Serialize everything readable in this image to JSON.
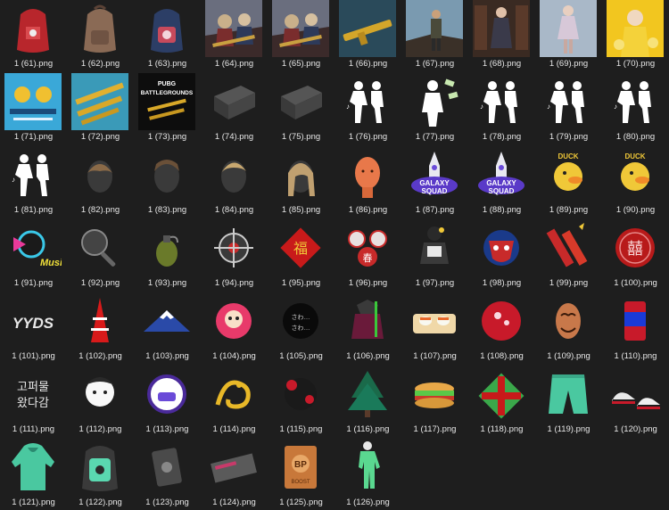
{
  "view": "large-icons",
  "files": [
    {
      "name": "1 (61).png",
      "icon": "red-backpack"
    },
    {
      "name": "1 (62).png",
      "icon": "brown-backpack"
    },
    {
      "name": "1 (63).png",
      "icon": "navy-backpack"
    },
    {
      "name": "1 (64).png",
      "icon": "battle-poster"
    },
    {
      "name": "1 (65).png",
      "icon": "battle-poster"
    },
    {
      "name": "1 (66).png",
      "icon": "golden-rifle"
    },
    {
      "name": "1 (67).png",
      "icon": "soldier-scene"
    },
    {
      "name": "1 (68).png",
      "icon": "woman-library"
    },
    {
      "name": "1 (69).png",
      "icon": "woman-street"
    },
    {
      "name": "1 (70).png",
      "icon": "yellow-poster"
    },
    {
      "name": "1 (71).png",
      "icon": "blue-event-banner"
    },
    {
      "name": "1 (72).png",
      "icon": "golden-weapons-banner"
    },
    {
      "name": "1 (73).png",
      "icon": "battlegrounds-poster"
    },
    {
      "name": "1 (74).png",
      "icon": "grey-crate"
    },
    {
      "name": "1 (75).png",
      "icon": "grey-crate"
    },
    {
      "name": "1 (76).png",
      "icon": "dance-emote"
    },
    {
      "name": "1 (77).png",
      "icon": "money-emote"
    },
    {
      "name": "1 (78).png",
      "icon": "dance-emote"
    },
    {
      "name": "1 (79).png",
      "icon": "dance-emote"
    },
    {
      "name": "1 (80).png",
      "icon": "dance-emote"
    },
    {
      "name": "1 (81).png",
      "icon": "dance-emote"
    },
    {
      "name": "1 (82).png",
      "icon": "hair-bowl"
    },
    {
      "name": "1 (83).png",
      "icon": "hair-short"
    },
    {
      "name": "1 (84).png",
      "icon": "hair-blond"
    },
    {
      "name": "1 (85).png",
      "icon": "hair-long"
    },
    {
      "name": "1 (86).png",
      "icon": "orange-head"
    },
    {
      "name": "1 (87).png",
      "icon": "galaxy-squad-logo"
    },
    {
      "name": "1 (88).png",
      "icon": "galaxy-squad-logo"
    },
    {
      "name": "1 (89).png",
      "icon": "duck-logo"
    },
    {
      "name": "1 (90).png",
      "icon": "duck-logo"
    },
    {
      "name": "1 (91).png",
      "icon": "music-spray"
    },
    {
      "name": "1 (92).png",
      "icon": "pan-icon"
    },
    {
      "name": "1 (93).png",
      "icon": "grenade-icon"
    },
    {
      "name": "1 (94).png",
      "icon": "crosshair-icon"
    },
    {
      "name": "1 (95).png",
      "icon": "red-diamond-charm"
    },
    {
      "name": "1 (96).png",
      "icon": "lanterns-spray"
    },
    {
      "name": "1 (97).png",
      "icon": "soldier-figure"
    },
    {
      "name": "1 (98).png",
      "icon": "mask-emblem"
    },
    {
      "name": "1 (99).png",
      "icon": "firecracker-icon"
    },
    {
      "name": "1 (100).png",
      "icon": "red-seal"
    },
    {
      "name": "1 (101).png",
      "icon": "yyds-text"
    },
    {
      "name": "1 (102).png",
      "icon": "tower-icon"
    },
    {
      "name": "1 (103).png",
      "icon": "mountain-icon"
    },
    {
      "name": "1 (104).png",
      "icon": "daruma-icon"
    },
    {
      "name": "1 (105).png",
      "icon": "black-ink-spray"
    },
    {
      "name": "1 (106).png",
      "icon": "samurai-figure"
    },
    {
      "name": "1 (107).png",
      "icon": "sushi-icon"
    },
    {
      "name": "1 (108).png",
      "icon": "red-circle-icon"
    },
    {
      "name": "1 (109).png",
      "icon": "mask-icon"
    },
    {
      "name": "1 (110).png",
      "icon": "can-icon"
    },
    {
      "name": "1 (111).png",
      "icon": "korean-text"
    },
    {
      "name": "1 (112).png",
      "icon": "cartoon-face"
    },
    {
      "name": "1 (113).png",
      "icon": "purple-badge"
    },
    {
      "name": "1 (114).png",
      "icon": "dragon-icon"
    },
    {
      "name": "1 (115).png",
      "icon": "ink-splat-icon"
    },
    {
      "name": "1 (116).png",
      "icon": "tree-icon"
    },
    {
      "name": "1 (117).png",
      "icon": "sandwich-icon"
    },
    {
      "name": "1 (118).png",
      "icon": "gift-box-icon"
    },
    {
      "name": "1 (119).png",
      "icon": "shorts-icon"
    },
    {
      "name": "1 (120).png",
      "icon": "sneakers-icon"
    },
    {
      "name": "1 (121).png",
      "icon": "hoodie-icon"
    },
    {
      "name": "1 (122).png",
      "icon": "teal-backpack"
    },
    {
      "name": "1 (123).png",
      "icon": "metal-plate-icon"
    },
    {
      "name": "1 (124).png",
      "icon": "ticket-icon"
    },
    {
      "name": "1 (125).png",
      "icon": "bp-card-icon"
    },
    {
      "name": "1 (126).png",
      "icon": "suit-icon"
    }
  ],
  "text": {
    "korean": "고퍼물 왔다감",
    "yyds": "YYDS",
    "galaxy": "GALAXY",
    "squad": "SQUAD",
    "pubg": "PUBG",
    "battlegrounds": "BATTLEGROUNDS",
    "music": "Music",
    "bp": "BP",
    "boost": "BOOST",
    "duck": "DUCK"
  }
}
